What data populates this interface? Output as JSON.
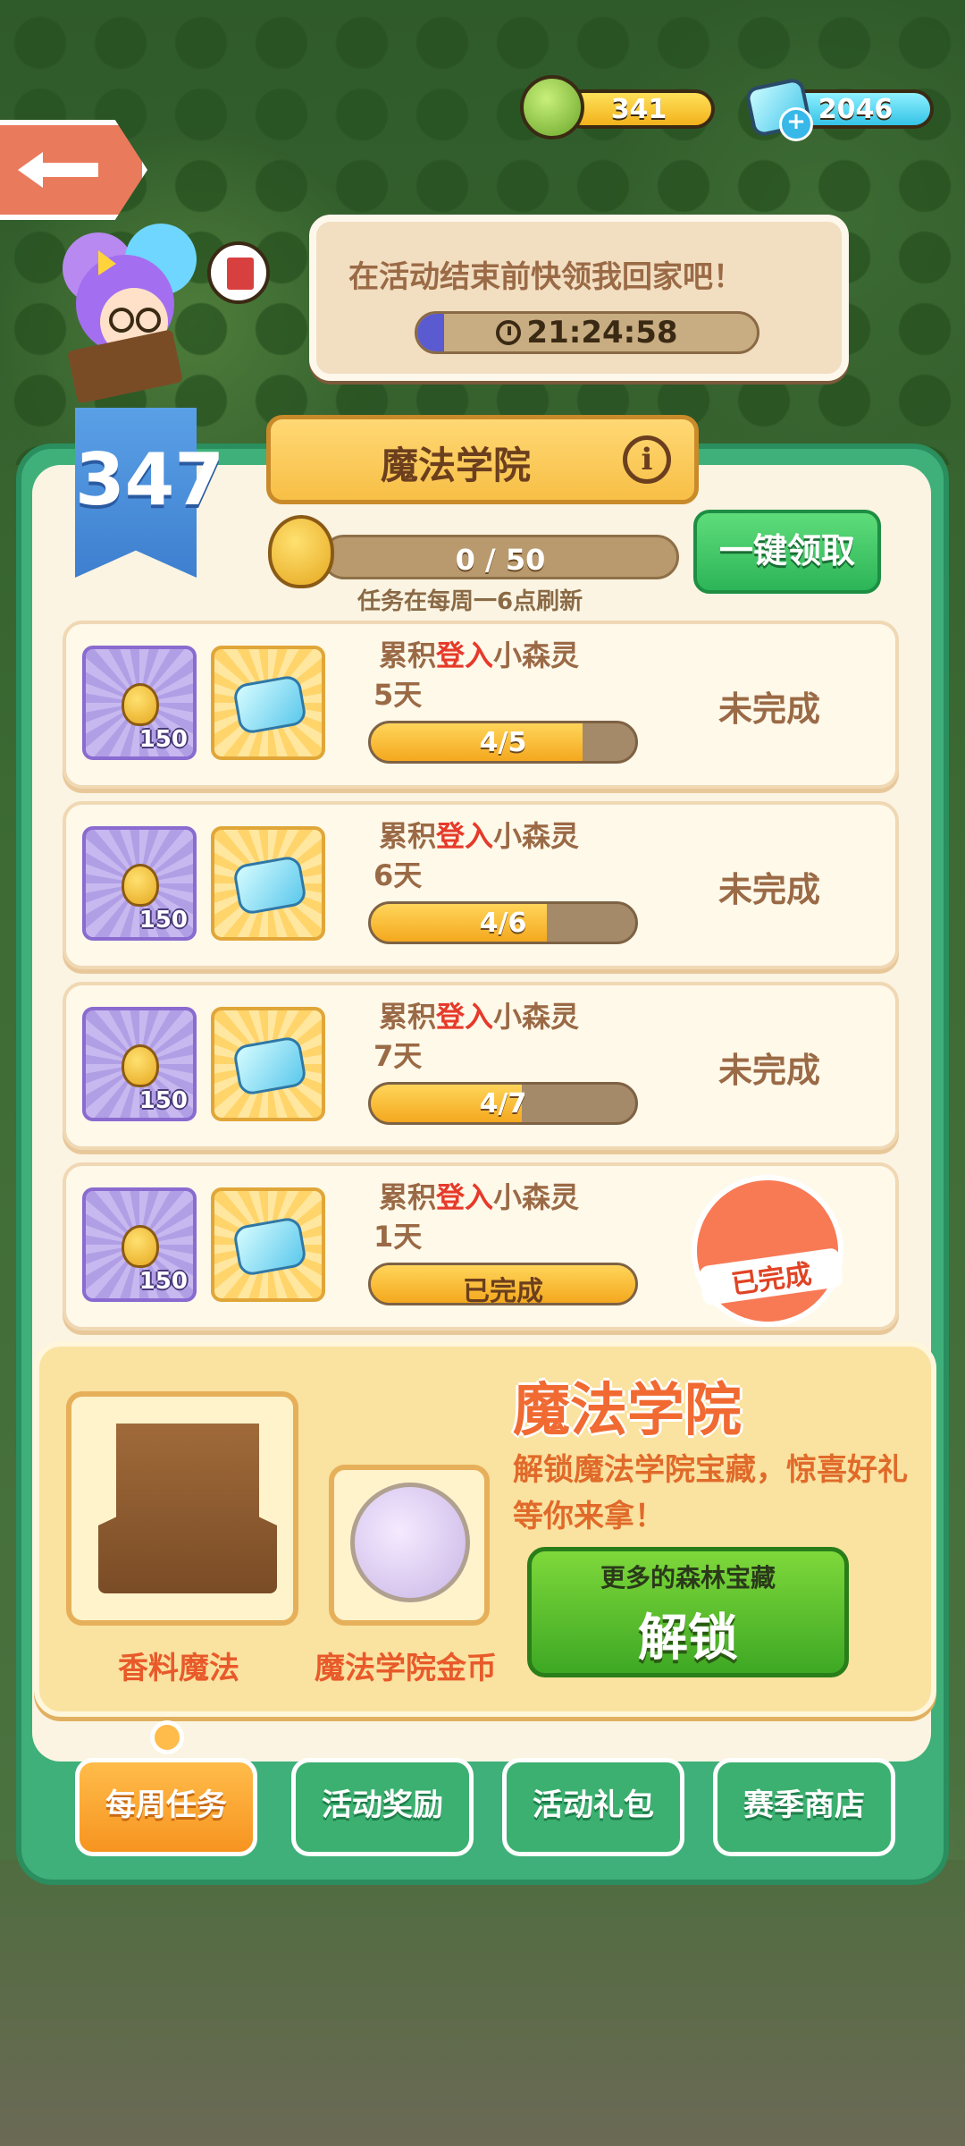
{
  "currency": {
    "gold_value": "341",
    "gem_value": "2046"
  },
  "speech": {
    "message": "在活动结束前快领我回家吧！",
    "timer": "21:24:58"
  },
  "level": {
    "value": "347"
  },
  "panel": {
    "title": "魔法学院",
    "progress_text": "0 / 50",
    "refresh_note": "任务在每周一6点刷新",
    "claim_all_label": "一键领取"
  },
  "tasks": [
    {
      "line1_pre": "累积",
      "line1_hl": "登入",
      "line1_post": "小森灵",
      "line2": "5天",
      "reward_count": "150",
      "progress_text": "4/5",
      "progress": 0.8,
      "status": "未完成"
    },
    {
      "line1_pre": "累积",
      "line1_hl": "登入",
      "line1_post": "小森灵",
      "line2": "6天",
      "reward_count": "150",
      "progress_text": "4/6",
      "progress": 0.667,
      "status": "未完成"
    },
    {
      "line1_pre": "累积",
      "line1_hl": "登入",
      "line1_post": "小森灵",
      "line2": "7天",
      "reward_count": "150",
      "progress_text": "4/7",
      "progress": 0.571,
      "status": "未完成"
    },
    {
      "line1_pre": "累积",
      "line1_hl": "登入",
      "line1_post": "小森灵",
      "line2": "1天",
      "reward_count": "150",
      "progress_text": "已完成",
      "progress": 1.0,
      "status": "已完成"
    }
  ],
  "promo": {
    "title": "魔法学院",
    "description": "解锁魔法学院宝藏，惊喜好礼等你来拿！",
    "item1_label": "香料魔法",
    "item2_label": "魔法学院金币",
    "unlock_sub": "更多的森林宝藏",
    "unlock_main": "解锁"
  },
  "tabs": [
    {
      "label": "每周任务",
      "active": true
    },
    {
      "label": "活动奖励",
      "active": false
    },
    {
      "label": "活动礼包",
      "active": false
    },
    {
      "label": "赛季商店",
      "active": false
    }
  ],
  "colors": {
    "panel_green": "#3fb07a",
    "accent_orange": "#f79420",
    "highlight_red": "#e63a2a"
  }
}
